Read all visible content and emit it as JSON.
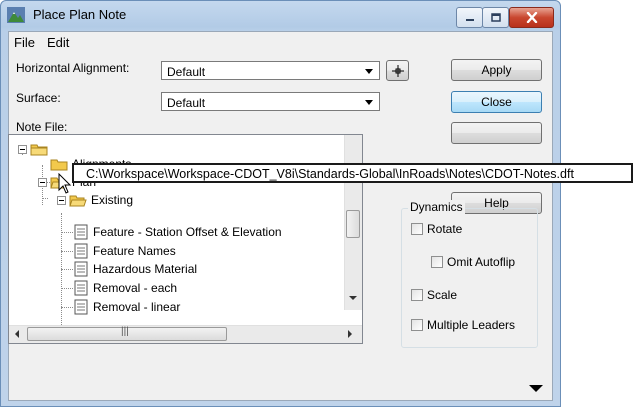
{
  "window": {
    "title": "Place Plan Note"
  },
  "menu": [
    "File",
    "Edit"
  ],
  "form": {
    "horizontal_alignment_label": "Horizontal Alignment:",
    "horizontal_alignment_value": "Default",
    "surface_label": "Surface:",
    "surface_value": "Default",
    "note_file_label": "Note File:"
  },
  "buttons": {
    "apply": "Apply",
    "close": "Close",
    "help": "Help"
  },
  "tree": {
    "items": [
      {
        "label": ""
      },
      {
        "label": "Alignments"
      },
      {
        "label": "Plan"
      },
      {
        "label": "Existing"
      },
      {
        "label": "Feature - Station Offset & Elevation"
      },
      {
        "label": "Feature Names"
      },
      {
        "label": "Hazardous Material"
      },
      {
        "label": "Removal - each"
      },
      {
        "label": "Removal - linear"
      }
    ]
  },
  "tooltip": {
    "path": "C:\\Workspace\\Workspace-CDOT_V8i\\Standards-Global\\InRoads\\Notes\\CDOT-Notes.dft"
  },
  "dynamics": {
    "title": "Dynamics",
    "rotate": {
      "label": "Rotate",
      "checked": false
    },
    "omit_autoflip": {
      "label": "Omit Autoflip",
      "checked": false
    },
    "scale": {
      "label": "Scale",
      "checked": false
    },
    "multiple_leaders": {
      "label": "Multiple Leaders",
      "checked": false
    }
  },
  "colors": {
    "close_button": "#c9472f",
    "window_frame": "#b9cfe8",
    "default_button": "#a7d9f5",
    "folder": "#f2c94c"
  },
  "icons": [
    "app-icon",
    "minimize-icon",
    "maximize-icon",
    "close-icon",
    "target-icon",
    "folder-icon",
    "document-icon",
    "mouse-cursor-icon",
    "chevron-down-icon"
  ]
}
